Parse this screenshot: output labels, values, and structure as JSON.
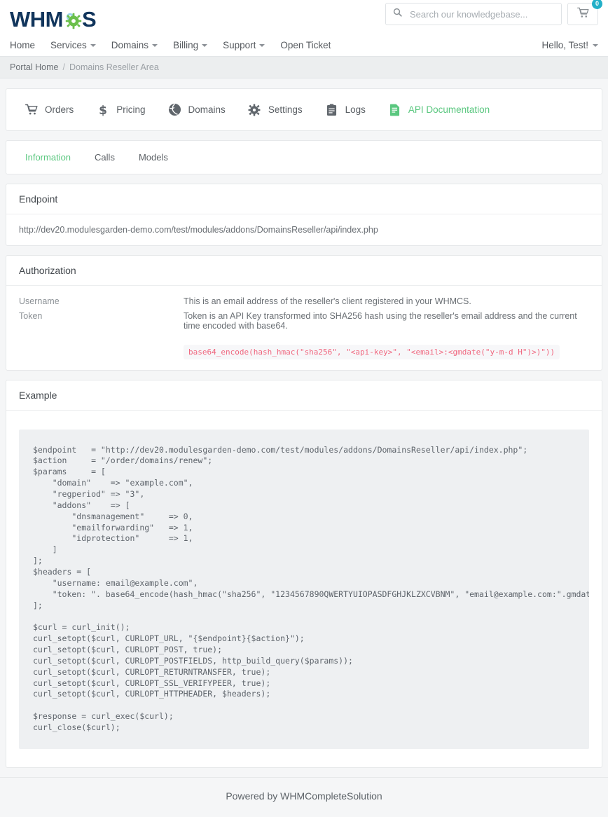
{
  "header": {
    "logo_text_left": "WHM",
    "logo_text_right": "S",
    "logo_gear_icon": "gear-icon",
    "search": {
      "placeholder": "Search our knowledgebase...",
      "value": "",
      "icon": "search-icon"
    },
    "cart": {
      "icon": "shopping-cart-icon",
      "badge": "0"
    }
  },
  "nav": {
    "items": [
      {
        "label": "Home",
        "has_caret": false
      },
      {
        "label": "Services",
        "has_caret": true
      },
      {
        "label": "Domains",
        "has_caret": true
      },
      {
        "label": "Billing",
        "has_caret": true
      },
      {
        "label": "Support",
        "has_caret": true
      },
      {
        "label": "Open Ticket",
        "has_caret": false
      }
    ],
    "account": {
      "label": "Hello, Test!",
      "has_caret": true
    }
  },
  "breadcrumb": {
    "home": "Portal Home",
    "separator": "/",
    "current": "Domains Reseller Area"
  },
  "toolbar": {
    "items": [
      {
        "label": "Orders",
        "icon": "shopping-cart-icon",
        "active": false
      },
      {
        "label": "Pricing",
        "icon": "dollar-sign-icon",
        "active": false
      },
      {
        "label": "Domains",
        "icon": "globe-icon",
        "active": false
      },
      {
        "label": "Settings",
        "icon": "gear-icon",
        "active": false
      },
      {
        "label": "Logs",
        "icon": "clipboard-icon",
        "active": false
      },
      {
        "label": "API Documentation",
        "icon": "file-document-icon",
        "active": true
      }
    ],
    "active_color": "#5ac77f"
  },
  "tabs": {
    "items": [
      {
        "label": "Information",
        "active": true
      },
      {
        "label": "Calls",
        "active": false
      },
      {
        "label": "Models",
        "active": false
      }
    ]
  },
  "endpoint": {
    "title": "Endpoint",
    "url": "http://dev20.modulesgarden-demo.com/test/modules/addons/DomainsReseller/api/index.php"
  },
  "authorization": {
    "title": "Authorization",
    "rows": [
      {
        "label": "Username",
        "description": "This is an email address of the reseller's client registered in your WHMCS."
      },
      {
        "label": "Token",
        "description": "Token is an API Key transformed into SHA256 hash using the reseller's email address and the current time encoded with base64."
      }
    ],
    "code_snippet": "base64_encode(hash_hmac(\"sha256\", \"<api-key>\", \"<email>:<gmdate(\"y-m-d H\")>)\"))",
    "code_color": "#f0677f"
  },
  "example": {
    "title": "Example",
    "code": "$endpoint   = \"http://dev20.modulesgarden-demo.com/test/modules/addons/DomainsReseller/api/index.php\";\n$action     = \"/order/domains/renew\";\n$params     = [\n    \"domain\"    => \"example.com\",\n    \"regperiod\" => \"3\",\n    \"addons\"    => [\n        \"dnsmanagement\"     => 0,\n        \"emailforwarding\"   => 1,\n        \"idprotection\"      => 1,\n    ]\n];\n$headers = [\n    \"username: email@example.com\",\n    \"token: \". base64_encode(hash_hmac(\"sha256\", \"1234567890QWERTYUIOPASDFGHJKLZXCVBNM\", \"email@example.com:\".gmdate(\"y-m-d H\")))\n];\n\n$curl = curl_init();\ncurl_setopt($curl, CURLOPT_URL, \"{$endpoint}{$action}\");\ncurl_setopt($curl, CURLOPT_POST, true);\ncurl_setopt($curl, CURLOPT_POSTFIELDS, http_build_query($params));\ncurl_setopt($curl, CURLOPT_RETURNTRANSFER, true);\ncurl_setopt($curl, CURLOPT_SSL_VERIFYPEER, true);\ncurl_setopt($curl, CURLOPT_HTTPHEADER, $headers);\n\n$response = curl_exec($curl);\ncurl_close($curl);"
  },
  "footer": {
    "text": "Powered by WHMCompleteSolution"
  }
}
